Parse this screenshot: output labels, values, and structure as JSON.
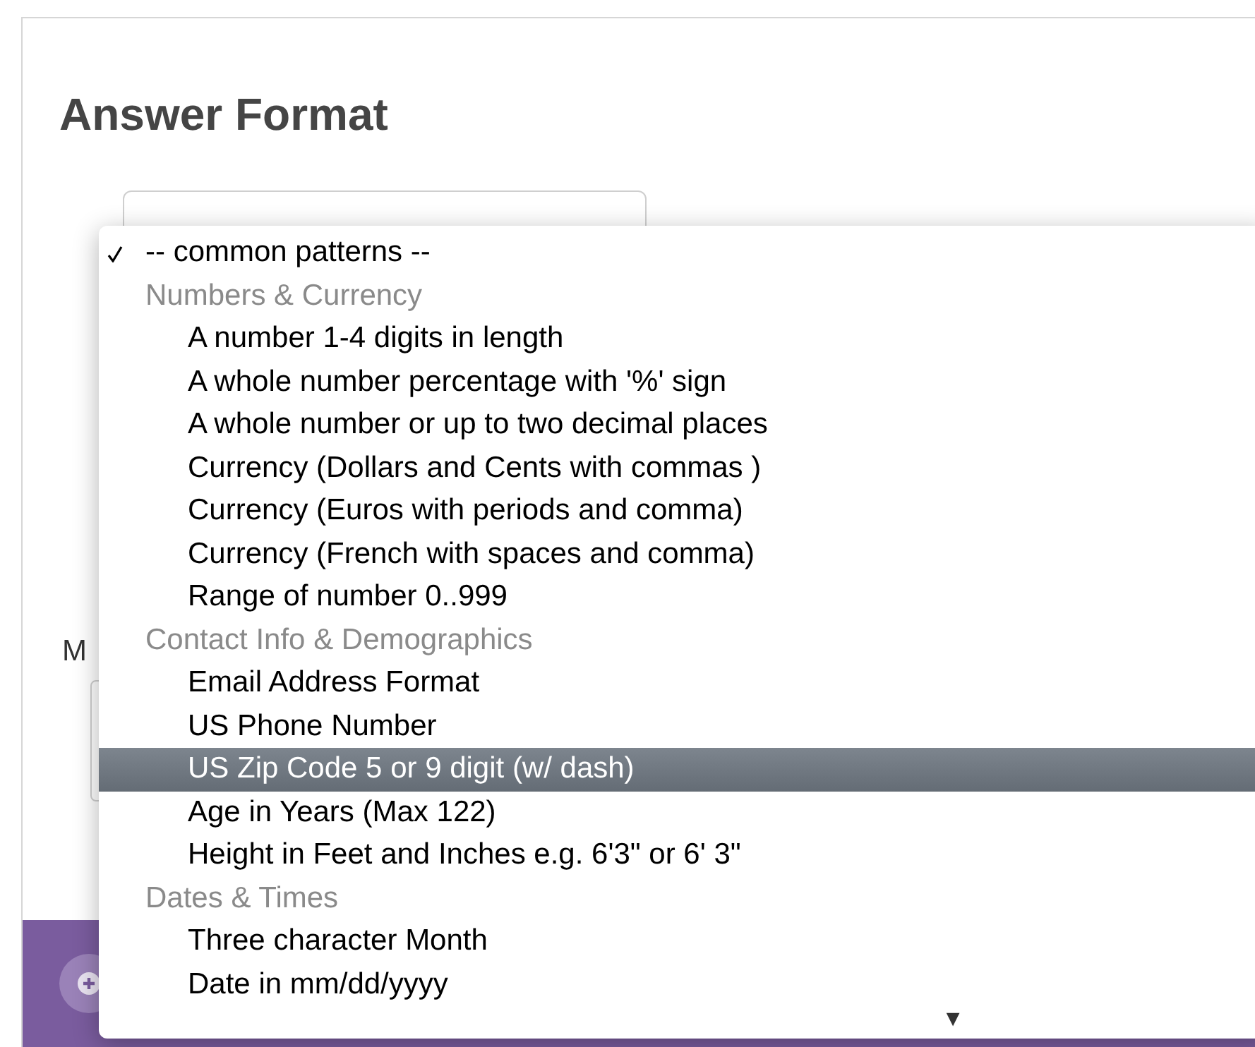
{
  "heading": "Answer Format",
  "message_label": "M",
  "menu": {
    "items": [
      {
        "kind": "option",
        "label": "-- common patterns --",
        "checked": true,
        "selected": false
      },
      {
        "kind": "group",
        "label": "Numbers & Currency"
      },
      {
        "kind": "option",
        "label": "A number 1-4 digits in length",
        "checked": false,
        "selected": false
      },
      {
        "kind": "option",
        "label": "A whole number percentage with '%' sign",
        "checked": false,
        "selected": false
      },
      {
        "kind": "option",
        "label": "A whole number or up to two decimal places",
        "checked": false,
        "selected": false
      },
      {
        "kind": "option",
        "label": "Currency (Dollars and Cents with commas )",
        "checked": false,
        "selected": false
      },
      {
        "kind": "option",
        "label": "Currency (Euros with periods and comma)",
        "checked": false,
        "selected": false
      },
      {
        "kind": "option",
        "label": "Currency (French with spaces and comma)",
        "checked": false,
        "selected": false
      },
      {
        "kind": "option",
        "label": "Range of number 0..999",
        "checked": false,
        "selected": false
      },
      {
        "kind": "group",
        "label": "Contact Info & Demographics"
      },
      {
        "kind": "option",
        "label": "Email Address Format",
        "checked": false,
        "selected": false
      },
      {
        "kind": "option",
        "label": "US Phone Number",
        "checked": false,
        "selected": false
      },
      {
        "kind": "option",
        "label": "US Zip Code 5 or 9 digit (w/ dash)",
        "checked": false,
        "selected": true
      },
      {
        "kind": "option",
        "label": "Age in Years (Max 122)",
        "checked": false,
        "selected": false
      },
      {
        "kind": "option",
        "label": "Height in Feet and Inches e.g. 6'3\" or 6' 3\"",
        "checked": false,
        "selected": false
      },
      {
        "kind": "group",
        "label": "Dates & Times"
      },
      {
        "kind": "option",
        "label": "Three character Month",
        "checked": false,
        "selected": false
      },
      {
        "kind": "option",
        "label": "Date in mm/dd/yyyy",
        "checked": false,
        "selected": false
      }
    ],
    "scroll_arrow": "▼"
  }
}
